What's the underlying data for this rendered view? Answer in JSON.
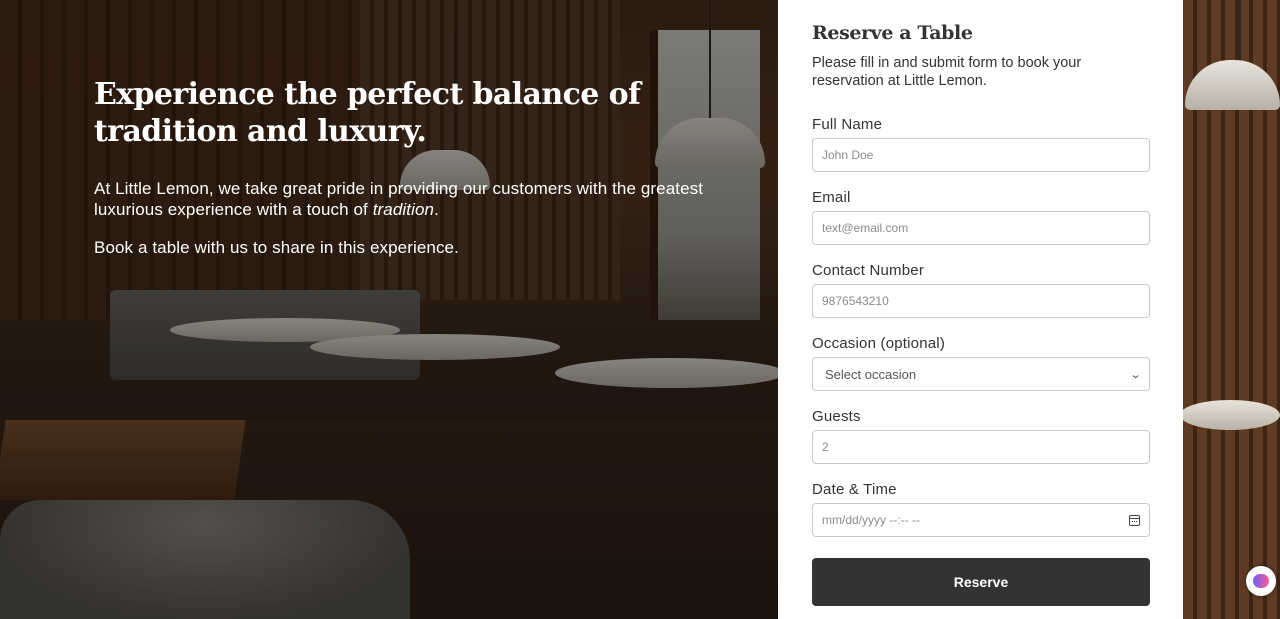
{
  "hero": {
    "title": "Experience the perfect balance of tradition and luxury.",
    "para1_before": "At Little Lemon, we take great pride in providing our customers with the greatest luxurious experience with a touch of ",
    "para1_em": "tradition",
    "para1_after": ".",
    "para2": "Book a table with us to share in this experience."
  },
  "form": {
    "title": "Reserve a Table",
    "subtitle": "Please fill in and submit form to book your reservation at Little Lemon.",
    "full_name": {
      "label": "Full Name",
      "placeholder": "John Doe"
    },
    "email": {
      "label": "Email",
      "placeholder": "text@email.com"
    },
    "contact": {
      "label": "Contact Number",
      "placeholder": "9876543210"
    },
    "occasion": {
      "label": "Occasion (optional)",
      "selected": "Select occasion"
    },
    "guests": {
      "label": "Guests",
      "value": "2"
    },
    "datetime": {
      "label": "Date & Time",
      "placeholder": "mm/dd/yyyy --:-- --"
    },
    "submit_label": "Reserve"
  },
  "icons": {
    "select": "chevron-down-icon",
    "calendar": "calendar-icon",
    "extension": "brain-extension-icon"
  },
  "colors": {
    "button": "#333333",
    "panel": "#ffffff",
    "hero_text": "#ffffff"
  }
}
